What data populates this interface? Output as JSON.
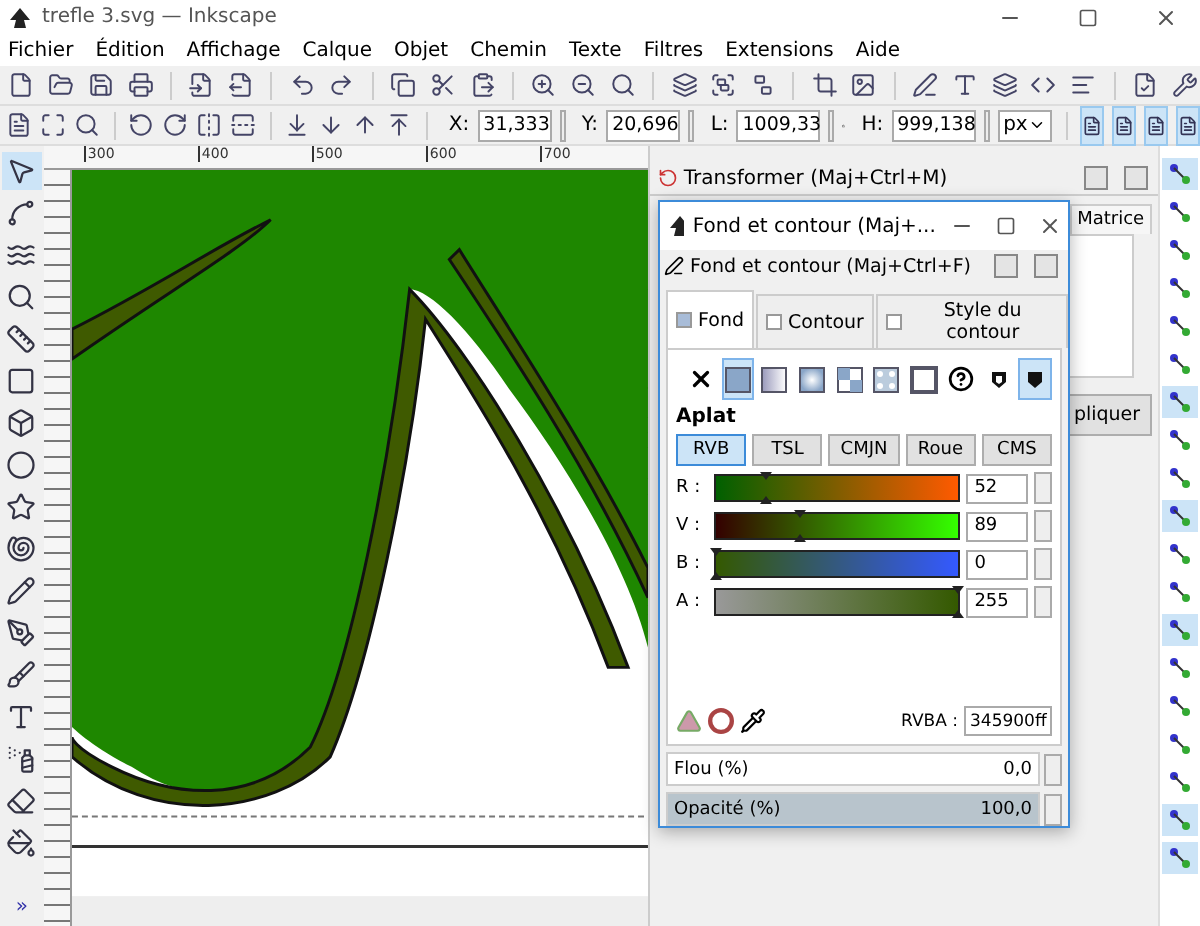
{
  "window": {
    "title": "trefle 3.svg — Inkscape"
  },
  "menu": [
    "Fichier",
    "Édition",
    "Affichage",
    "Calque",
    "Objet",
    "Chemin",
    "Texte",
    "Filtres",
    "Extensions",
    "Aide"
  ],
  "geometry": [
    {
      "label": "X:",
      "value": "31,333"
    },
    {
      "label": "Y:",
      "value": "20,696"
    },
    {
      "label": "L:",
      "value": "1009,33"
    },
    {
      "label": "H:",
      "value": "999,138"
    }
  ],
  "unit": "px",
  "tools": [
    {
      "kind": "selector",
      "selected": true
    },
    {
      "kind": "node",
      "selected": false
    },
    {
      "kind": "tweak",
      "selected": false
    },
    {
      "kind": "zoom",
      "selected": false
    },
    {
      "kind": "measure",
      "selected": false
    },
    {
      "kind": "rect",
      "selected": false
    },
    {
      "kind": "box",
      "selected": false
    },
    {
      "kind": "circle",
      "selected": false
    },
    {
      "kind": "star",
      "selected": false
    },
    {
      "kind": "spiral",
      "selected": false
    },
    {
      "kind": "pencil",
      "selected": false
    },
    {
      "kind": "pen",
      "selected": false
    },
    {
      "kind": "calligraphy",
      "selected": false
    },
    {
      "kind": "text",
      "selected": false
    },
    {
      "kind": "spray",
      "selected": false
    },
    {
      "kind": "eraser",
      "selected": false
    },
    {
      "kind": "bucket",
      "selected": false
    }
  ],
  "toolbox_more": "»",
  "ruler_labels": [
    "300",
    "400",
    "500",
    "600",
    "700"
  ],
  "snap_toggles": [
    {
      "on": true
    },
    {
      "on": false
    },
    {
      "on": false
    },
    {
      "on": false
    },
    {
      "on": false
    },
    {
      "on": false
    },
    {
      "on": true
    },
    {
      "on": false
    },
    {
      "on": false
    },
    {
      "on": true
    },
    {
      "on": false
    },
    {
      "on": false
    },
    {
      "on": true
    },
    {
      "on": false
    },
    {
      "on": false
    },
    {
      "on": false
    },
    {
      "on": false
    },
    {
      "on": true
    },
    {
      "on": true
    }
  ],
  "transform_panel": {
    "title": "Transformer (Maj+Ctrl+M)",
    "tab": "Matrice",
    "apply_button": "pliquer"
  },
  "fill_dialog": {
    "title": "Fond et contour (Maj+...",
    "header": "Fond et contour (Maj+Ctrl+F)",
    "tabs": [
      {
        "label": "Fond",
        "selected": true
      },
      {
        "label": "Contour",
        "selected": false
      },
      {
        "label": "Style du contour",
        "selected": false
      }
    ],
    "paint_types": [
      {
        "kind": "none",
        "selected": false
      },
      {
        "kind": "flat",
        "selected": true
      },
      {
        "kind": "linear",
        "selected": false
      },
      {
        "kind": "radial",
        "selected": false
      },
      {
        "kind": "pattern",
        "selected": false
      },
      {
        "kind": "mesh",
        "selected": false
      },
      {
        "kind": "swatch",
        "selected": false
      },
      {
        "kind": "unset",
        "selected": false
      }
    ],
    "fill_rules": [
      {
        "selected": false
      },
      {
        "selected": true
      }
    ],
    "paint_label": "Aplat",
    "modes": [
      {
        "label": "RVB",
        "selected": true
      },
      {
        "label": "TSL",
        "selected": false
      },
      {
        "label": "CMJN",
        "selected": false
      },
      {
        "label": "Roue",
        "selected": false
      },
      {
        "label": "CMS",
        "selected": false
      }
    ],
    "channels": [
      {
        "label": "R :",
        "value": "52",
        "level": 0.204
      },
      {
        "label": "V :",
        "value": "89",
        "level": 0.349
      },
      {
        "label": "B :",
        "value": "0",
        "level": 0
      },
      {
        "label": "A :",
        "value": "255",
        "level": 1
      }
    ],
    "rgba_label": "RVBA :",
    "rgba": "345900ff",
    "blur": {
      "label": "Flou (%)",
      "value": "0,0"
    },
    "opacity": {
      "label": "Opacité (%)",
      "value": "100,0",
      "level": 1
    }
  }
}
